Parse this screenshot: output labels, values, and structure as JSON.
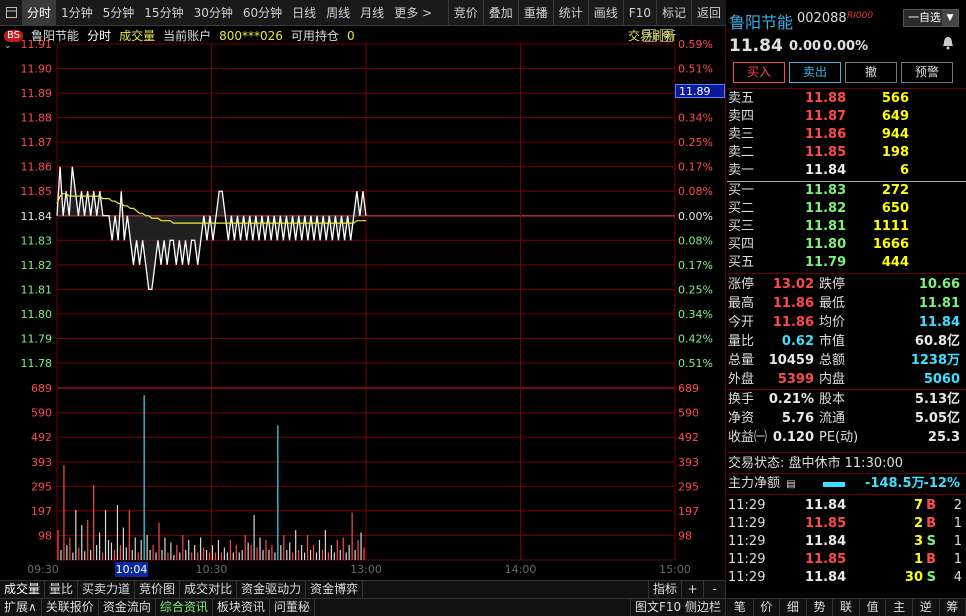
{
  "toolbar": {
    "left": [
      "分时",
      "1分钟",
      "5分钟",
      "15分钟",
      "30分钟",
      "60分钟",
      "日线",
      "周线",
      "月线",
      "更多 >"
    ],
    "right": [
      "竞价",
      "叠加",
      "重播",
      "统计",
      "画线",
      "F10",
      "标记",
      "返回"
    ]
  },
  "info": {
    "bs": "BS",
    "name": "鲁阳节能",
    "mode": "分时",
    "volume": "成交量",
    "account": "当前账户",
    "account_no": "800***026",
    "holding_label": "可用持仓",
    "holding": "0",
    "refresh": "交易刷新"
  },
  "chart_data": {
    "type": "line",
    "prev_close": 11.84,
    "y_price_ticks": [
      "11.91",
      "11.90",
      "11.89",
      "11.88",
      "11.87",
      "11.86",
      "11.85",
      "11.84",
      "11.83",
      "11.82",
      "11.81",
      "11.80",
      "11.79",
      "11.78"
    ],
    "y_pct_ticks": [
      "0.59%",
      "0.51%",
      "0.42%",
      "0.34%",
      "0.25%",
      "0.17%",
      "0.08%",
      "0.00%",
      "0.08%",
      "0.17%",
      "0.25%",
      "0.34%",
      "0.42%",
      "0.51%"
    ],
    "price_range": [
      11.78,
      11.91
    ],
    "vol_ticks": [
      "689",
      "590",
      "492",
      "393",
      "295",
      "197",
      "98"
    ],
    "vol_range": [
      0,
      689
    ],
    "x_ticks": [
      "09:30",
      "10:30",
      "13:00",
      "14:00",
      "15:00"
    ],
    "cursor_time": "10:04",
    "cursor_price": "11.89",
    "price": [
      11.84,
      11.86,
      11.84,
      11.85,
      11.84,
      11.86,
      11.85,
      11.84,
      11.85,
      11.84,
      11.85,
      11.84,
      11.85,
      11.84,
      11.85,
      11.84,
      11.84,
      11.84,
      11.83,
      11.84,
      11.83,
      11.85,
      11.83,
      11.84,
      11.83,
      11.82,
      11.83,
      11.82,
      11.83,
      11.82,
      11.81,
      11.81,
      11.82,
      11.83,
      11.82,
      11.83,
      11.82,
      11.83,
      11.83,
      11.82,
      11.83,
      11.82,
      11.83,
      11.82,
      11.83,
      11.83,
      11.82,
      11.83,
      11.84,
      11.83,
      11.84,
      11.83,
      11.84,
      11.85,
      11.85,
      11.84,
      11.83,
      11.84,
      11.83,
      11.84,
      11.83,
      11.84,
      11.83,
      11.84,
      11.83,
      11.84,
      11.83,
      11.84,
      11.83,
      11.84,
      11.83,
      11.84,
      11.83,
      11.84,
      11.83,
      11.84,
      11.83,
      11.84,
      11.83,
      11.84,
      11.83,
      11.84,
      11.83,
      11.84,
      11.83,
      11.84,
      11.83,
      11.84,
      11.83,
      11.84,
      11.83,
      11.84,
      11.83,
      11.84,
      11.83,
      11.84,
      11.83,
      11.84,
      11.85,
      11.84,
      11.85,
      11.84
    ],
    "avg": [
      11.845,
      11.848,
      11.849,
      11.849,
      11.848,
      11.848,
      11.848,
      11.848,
      11.848,
      11.848,
      11.848,
      11.848,
      11.848,
      11.848,
      11.848,
      11.847,
      11.847,
      11.847,
      11.846,
      11.846,
      11.845,
      11.845,
      11.844,
      11.844,
      11.843,
      11.843,
      11.842,
      11.841,
      11.841,
      11.84,
      11.84,
      11.839,
      11.839,
      11.839,
      11.838,
      11.838,
      11.838,
      11.838,
      11.837,
      11.837,
      11.837,
      11.837,
      11.837,
      11.837,
      11.837,
      11.837,
      11.837,
      11.837,
      11.837,
      11.837,
      11.837,
      11.837,
      11.837,
      11.837,
      11.837,
      11.837,
      11.837,
      11.837,
      11.837,
      11.837,
      11.837,
      11.837,
      11.837,
      11.837,
      11.837,
      11.837,
      11.837,
      11.837,
      11.837,
      11.837,
      11.837,
      11.837,
      11.837,
      11.837,
      11.837,
      11.837,
      11.837,
      11.837,
      11.837,
      11.837,
      11.837,
      11.837,
      11.837,
      11.837,
      11.837,
      11.837,
      11.837,
      11.837,
      11.837,
      11.837,
      11.837,
      11.837,
      11.837,
      11.837,
      11.837,
      11.837,
      11.837,
      11.837,
      11.838,
      11.838,
      11.838,
      11.838
    ],
    "volume": [
      120,
      40,
      380,
      60,
      90,
      30,
      200,
      50,
      140,
      35,
      160,
      40,
      300,
      60,
      110,
      30,
      200,
      80,
      70,
      40,
      220,
      60,
      130,
      50,
      200,
      40,
      90,
      30,
      80,
      660,
      100,
      40,
      60,
      30,
      150,
      40,
      90,
      30,
      70,
      20,
      60,
      30,
      100,
      40,
      80,
      30,
      60,
      30,
      90,
      50,
      40,
      30,
      60,
      30,
      80,
      30,
      50,
      30,
      80,
      30,
      60,
      30,
      40,
      100,
      70,
      60,
      180,
      50,
      90,
      40,
      80,
      40,
      60,
      30,
      540,
      60,
      100,
      40,
      70,
      30,
      120,
      40,
      60,
      30,
      100,
      40,
      60,
      30,
      80,
      40,
      120,
      30,
      60,
      30,
      80,
      40,
      90,
      30,
      60,
      190,
      40,
      80,
      110,
      50
    ],
    "vol_dir": [
      "r",
      "w",
      "r",
      "w",
      "r",
      "w",
      "w",
      "r",
      "w",
      "w",
      "r",
      "w",
      "r",
      "w",
      "w",
      "r",
      "w",
      "w",
      "w",
      "r",
      "w",
      "r",
      "w",
      "w",
      "r",
      "w",
      "w",
      "r",
      "w",
      "c",
      "w",
      "w",
      "r",
      "w",
      "r",
      "w",
      "w",
      "r",
      "w",
      "w",
      "r",
      "w",
      "r",
      "w",
      "w",
      "r",
      "w",
      "r",
      "w",
      "r",
      "w",
      "r",
      "w",
      "r",
      "w",
      "r",
      "w",
      "w",
      "r",
      "w",
      "r",
      "w",
      "w",
      "r",
      "w",
      "r",
      "w",
      "r",
      "w",
      "w",
      "r",
      "w",
      "r",
      "w",
      "c",
      "w",
      "r",
      "w",
      "w",
      "r",
      "w",
      "r",
      "w",
      "w",
      "r",
      "w",
      "r",
      "w",
      "w",
      "r",
      "w",
      "r",
      "w",
      "w",
      "r",
      "w",
      "r",
      "w",
      "w",
      "r",
      "w",
      "r",
      "w",
      "r"
    ]
  },
  "bottom_tabs": [
    "成交量",
    "量比",
    "买卖力道",
    "竞价图",
    "成交对比",
    "资金驱动力",
    "资金博弈"
  ],
  "bottom_tabs_right": [
    "指标",
    "+",
    "-"
  ],
  "bottom_bar": [
    "扩展∧",
    "关联报价",
    "资金流向",
    "综合资讯",
    "板块资讯",
    "问董秘"
  ],
  "bottom_bar_right": "图文F10 侧边栏",
  "quote": {
    "name": "鲁阳节能",
    "code": "002088",
    "badge": "RI000",
    "self_select": "一自选",
    "price": "11.84",
    "change": "0.00",
    "pct": "0.00%",
    "buy_label": "买入",
    "sell_label": "卖出",
    "cancel_label": "撤",
    "alert_label": "预警",
    "asks": [
      [
        "卖五",
        "11.88",
        "566"
      ],
      [
        "卖四",
        "11.87",
        "649"
      ],
      [
        "卖三",
        "11.86",
        "944"
      ],
      [
        "卖二",
        "11.85",
        "198"
      ],
      [
        "卖一",
        "11.84",
        "6"
      ]
    ],
    "bids": [
      [
        "买一",
        "11.83",
        "272"
      ],
      [
        "买二",
        "11.82",
        "650"
      ],
      [
        "买三",
        "11.81",
        "1111"
      ],
      [
        "买四",
        "11.80",
        "1666"
      ],
      [
        "买五",
        "11.79",
        "444"
      ]
    ],
    "stats1": [
      [
        "涨停",
        "13.02",
        "跌停",
        "10.66"
      ],
      [
        "最高",
        "11.86",
        "最低",
        "11.81"
      ],
      [
        "今开",
        "11.86",
        "均价",
        "11.84"
      ],
      [
        "量比",
        "0.62",
        "市值",
        "60.8亿"
      ],
      [
        "总量",
        "10459",
        "总额",
        "1238万"
      ],
      [
        "外盘",
        "5399",
        "内盘",
        "5060"
      ]
    ],
    "stats2": [
      [
        "换手",
        "0.21%",
        "股本",
        "5.13亿"
      ],
      [
        "净资",
        "5.76",
        "流通",
        "5.05亿"
      ],
      [
        "收益㈠",
        "0.120",
        "PE(动)",
        "25.3"
      ]
    ],
    "trade_state": "交易状态: 盘中休市 11:30:00",
    "main_flow_label": "主力净额",
    "main_flow_value": "-148.5万",
    "main_flow_pct": "-12%",
    "ticks": [
      [
        "11:29",
        "11.84",
        "7",
        "B",
        "2"
      ],
      [
        "11:29",
        "11.85",
        "2",
        "B",
        "1"
      ],
      [
        "11:29",
        "11.84",
        "3",
        "S",
        "1"
      ],
      [
        "11:29",
        "11.85",
        "1",
        "B",
        "1"
      ],
      [
        "11:29",
        "11.84",
        "30",
        "S",
        "4"
      ]
    ],
    "rtabs": [
      "笔",
      "价",
      "细",
      "势",
      "联",
      "值",
      "主",
      "逆",
      "筹"
    ]
  },
  "colors": {
    "up": "#ff4a4a",
    "down": "#7ef07e",
    "flat": "#e8e8e8",
    "price_line": "#ffffff",
    "avg_line": "#e8e840",
    "grid": "#7a0000",
    "cyan": "#3ee0ff"
  }
}
